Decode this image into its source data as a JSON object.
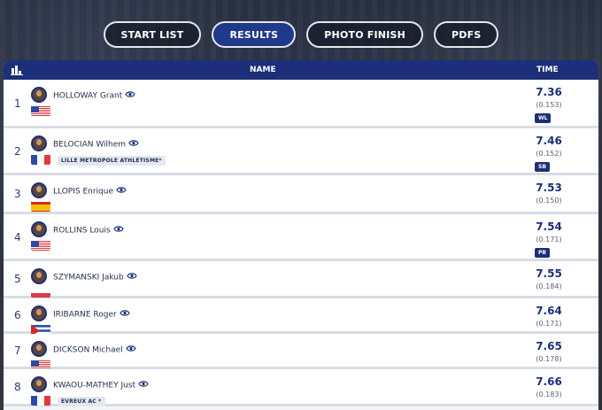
{
  "tabs": [
    {
      "label": "START LIST",
      "active": false
    },
    {
      "label": "RESULTS",
      "active": true
    },
    {
      "label": "PHOTO FINISH",
      "active": false
    },
    {
      "label": "PDFS",
      "active": false
    }
  ],
  "table": {
    "header_name": "NAME",
    "header_time": "TIME",
    "rows": [
      {
        "rank": "1",
        "name": "HOLLOWAY Grant",
        "club": "",
        "time": "7.36",
        "reaction": "(0.153)",
        "badge": "WL",
        "flag": "usa"
      },
      {
        "rank": "2",
        "name": "BELOCIAN Wilhem",
        "club": "LILLE METROPOLE ATHLETISME*",
        "time": "7.46",
        "reaction": "(0.152)",
        "badge": "SB",
        "flag": "france"
      },
      {
        "rank": "3",
        "name": "LLOPIS Enrique",
        "club": "",
        "time": "7.53",
        "reaction": "(0.150)",
        "badge": "",
        "flag": "spain"
      },
      {
        "rank": "4",
        "name": "ROLLINS Louis",
        "club": "",
        "time": "7.54",
        "reaction": "(0.171)",
        "badge": "PB",
        "flag": "usa"
      },
      {
        "rank": "5",
        "name": "SZYMANSKI Jakub",
        "club": "",
        "time": "7.55",
        "reaction": "(0.184)",
        "badge": "",
        "flag": "poland"
      },
      {
        "rank": "6",
        "name": "IRIBARNE Roger",
        "club": "",
        "time": "7.64",
        "reaction": "(0.171)",
        "badge": "",
        "flag": "cuba"
      },
      {
        "rank": "7",
        "name": "DICKSON Michael",
        "club": "",
        "time": "7.65",
        "reaction": "(0.178)",
        "badge": "",
        "flag": "usa"
      },
      {
        "rank": "8",
        "name": "KWAOU-MATHEY Just",
        "club": "EVREUX AC *",
        "time": "7.66",
        "reaction": "(0.183)",
        "badge": "",
        "flag": "france"
      }
    ]
  },
  "icons": {
    "chart": "bar-chart-icon",
    "eye": "eye-icon",
    "avatar": "athlete-avatar"
  },
  "colors": {
    "header": "#1d2f7a",
    "active_tab": "#1f3a8a",
    "time": "#1d2f7a"
  }
}
